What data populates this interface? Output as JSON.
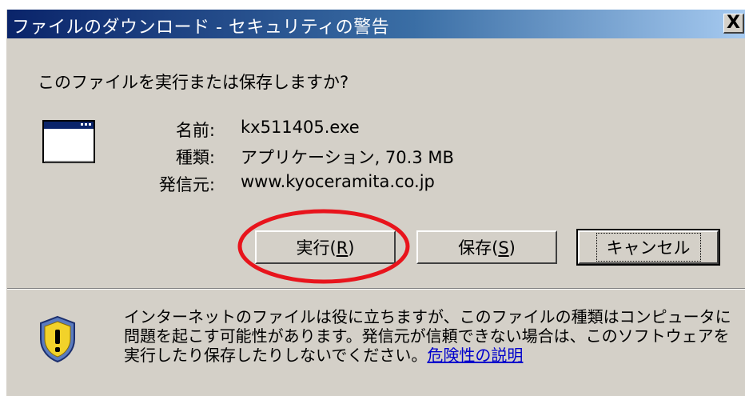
{
  "dialog": {
    "title": "ファイルのダウンロード - セキュリティの警告",
    "close_label": "X",
    "question": "このファイルを実行または保存しますか?",
    "fields": {
      "name_label": "名前:",
      "name_value": "kx511405.exe",
      "type_label": "種類:",
      "type_value": "アプリケーション, 70.3 MB",
      "from_label": "発信元:",
      "from_value": "www.kyoceramita.co.jp"
    },
    "buttons": {
      "run_text": "実行(",
      "run_mnemonic": "R",
      "run_close": ")",
      "save_text": "保存(",
      "save_mnemonic": "S",
      "save_close": ")",
      "cancel": "キャンセル"
    },
    "warning": {
      "text": "インターネットのファイルは役に立ちますが、このファイルの種類はコンピュータに問題を起こす可能性があります。発信元が信頼できない場合は、このソフトウェアを実行したり保存したりしないでください。",
      "link": "危険性の説明"
    },
    "icons": {
      "app": "application-window-icon",
      "warning": "security-shield-warning-icon"
    },
    "colors": {
      "annotation_circle": "#e8141c",
      "titlebar_start": "#0a246a",
      "link": "#0000cc"
    }
  }
}
